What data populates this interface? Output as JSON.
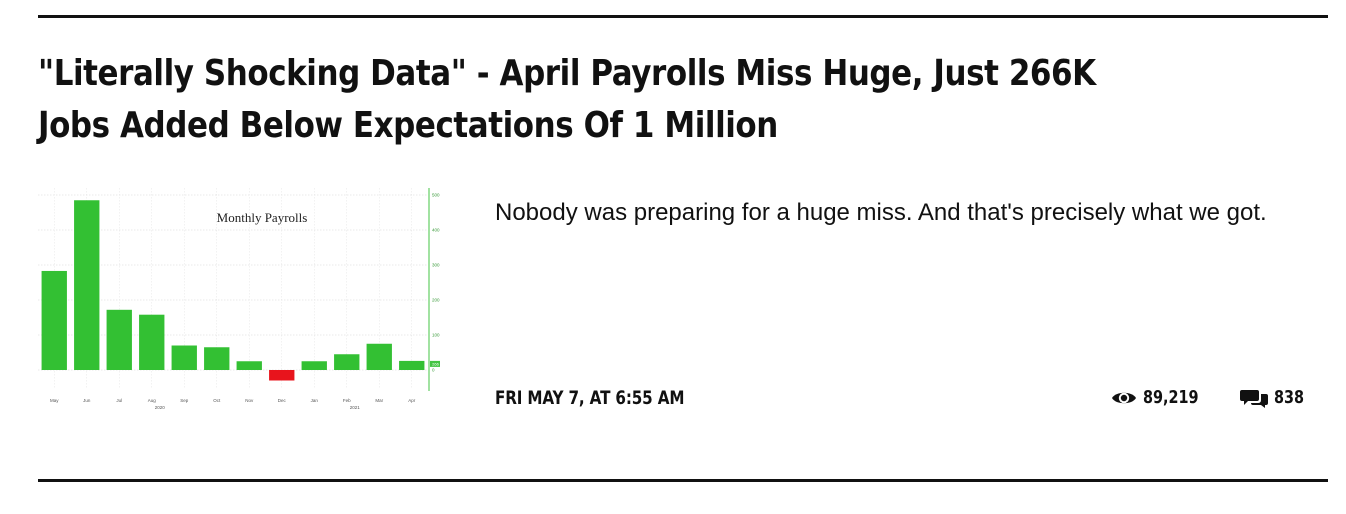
{
  "article": {
    "headline": "\"Literally Shocking Data\" - April Payrolls Miss Huge, Just 266K Jobs Added Below Expectations Of 1 Million",
    "teaser": "Nobody was preparing for a huge miss. And that's precisely what we got.",
    "date": "FRI MAY 7, AT 6:55 AM",
    "views": "89,219",
    "comments": "838",
    "icons": {
      "views": "eye-icon",
      "comments": "comments-icon"
    }
  },
  "chart_data": {
    "type": "bar",
    "title": "Monthly Payrolls",
    "categories": [
      "May",
      "Jun",
      "Jul",
      "Aug",
      "Sep",
      "Oct",
      "Nov",
      "Dec",
      "Jan",
      "Feb",
      "Mar",
      "Apr"
    ],
    "values": [
      283,
      485,
      172,
      158,
      70,
      65,
      25,
      -30,
      25,
      45,
      75,
      26
    ],
    "year_labels": [
      {
        "label": "2020",
        "at": "Aug"
      },
      {
        "label": "2021",
        "at": "Feb"
      }
    ],
    "y_ticks": [
      "500",
      "400",
      "300",
      "200",
      "100",
      "0"
    ],
    "ylim": [
      -50,
      520
    ],
    "colors": {
      "positive": "#33c033",
      "negative": "#e8141c",
      "axis": "#43c443"
    },
    "last_value_label": "266"
  }
}
